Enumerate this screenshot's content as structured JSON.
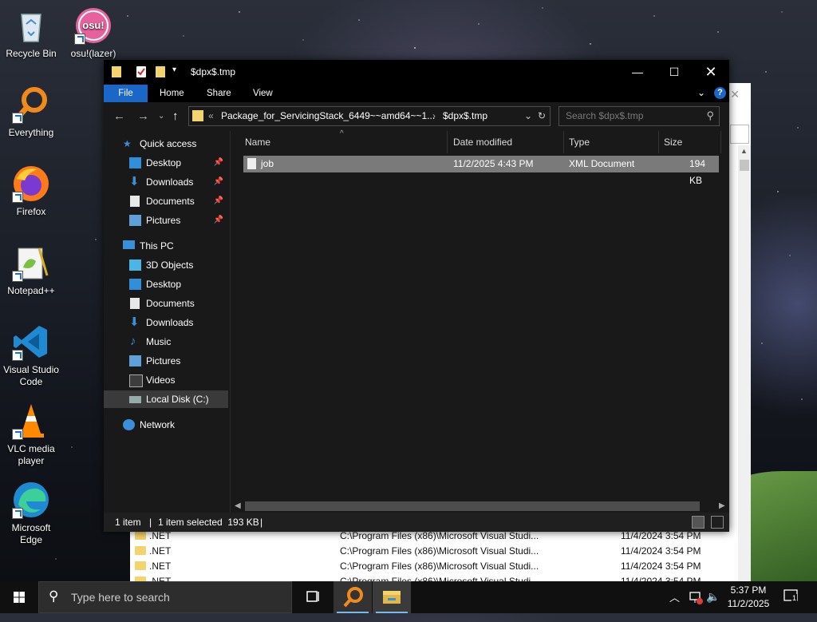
{
  "desktop": {
    "icons": [
      {
        "label": "Recycle Bin"
      },
      {
        "label": "osu!(lazer)",
        "logo_text": "osu!"
      },
      {
        "label": "Everything"
      },
      {
        "label": "Firefox"
      },
      {
        "label": "Notepad++"
      },
      {
        "label": "Visual Studio Code"
      },
      {
        "label": "VLC media player"
      },
      {
        "label": "Microsoft Edge"
      }
    ]
  },
  "background_window": {
    "rows": [
      {
        "name": ".NET",
        "path": "C:\\Program Files (x86)\\Microsoft Visual Studi...",
        "date": "11/4/2024 3:54 PM"
      },
      {
        "name": ".NET",
        "path": "C:\\Program Files (x86)\\Microsoft Visual Studi...",
        "date": "11/4/2024 3:54 PM"
      },
      {
        "name": ".NET",
        "path": "C:\\Program Files (x86)\\Microsoft Visual Studi...",
        "date": "11/4/2024 3:54 PM"
      },
      {
        "name": ".NET",
        "path": "C:\\Program Files (x86)\\Microsoft Visual Studi...",
        "date": "11/4/2024 3:54 PM"
      }
    ]
  },
  "explorer": {
    "title": "$dpx$.tmp",
    "ribbon": {
      "tabs": [
        "File",
        "Home",
        "Share",
        "View"
      ]
    },
    "address": {
      "overflow": "«",
      "segments": [
        "Package_for_ServicingStack_6449~~amd64~~1...",
        "$dpx$.tmp"
      ],
      "separator": "›"
    },
    "search": {
      "placeholder": "Search $dpx$.tmp"
    },
    "nav": {
      "quick_access": {
        "label": "Quick access",
        "items": [
          "Desktop",
          "Downloads",
          "Documents",
          "Pictures"
        ]
      },
      "this_pc": {
        "label": "This PC",
        "items": [
          "3D Objects",
          "Desktop",
          "Documents",
          "Downloads",
          "Music",
          "Pictures",
          "Videos",
          "Local Disk (C:)"
        ]
      },
      "network": {
        "label": "Network"
      }
    },
    "columns": [
      "Name",
      "Date modified",
      "Type",
      "Size"
    ],
    "files": [
      {
        "name": "job",
        "date": "11/2/2025 4:43 PM",
        "type": "XML Document",
        "size": "194 KB",
        "selected": true
      }
    ],
    "status": {
      "count": "1 item",
      "selection": "1 item selected  193 KB"
    }
  },
  "taskbar": {
    "search_placeholder": "Type here to search",
    "time": "5:37 PM",
    "date": "11/2/2025",
    "notifications": "1"
  },
  "colors": {
    "accent": "#1a67c7",
    "selection": "#7a7a7a",
    "folder": "#f3d36b"
  }
}
